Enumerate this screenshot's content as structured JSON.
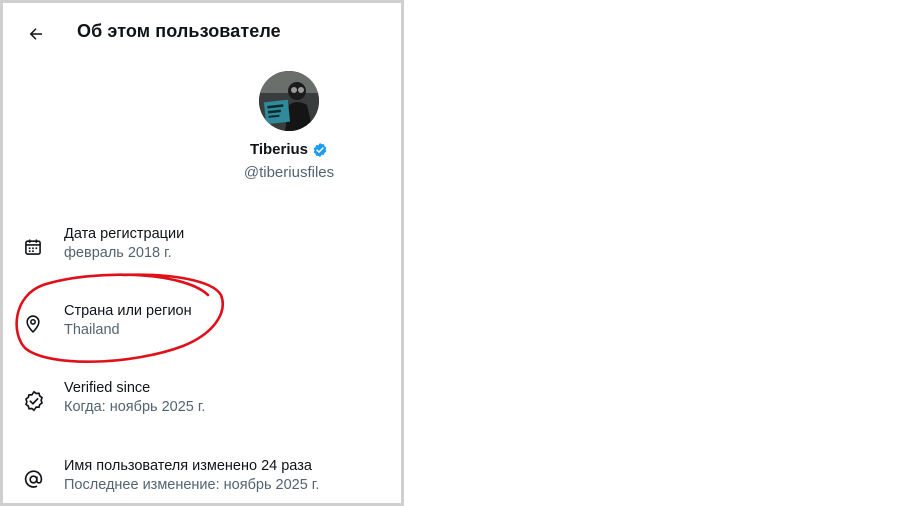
{
  "header": {
    "title": "Об этом пользователе"
  },
  "profile": {
    "name": "Tiberius",
    "handle": "@tiberiusfiles"
  },
  "rows": [
    {
      "title": "Дата регистрации",
      "subtitle": "февраль 2018 г.",
      "icon": "calendar-icon"
    },
    {
      "title": "Страна или регион",
      "subtitle": "Thailand",
      "icon": "location-pin-icon"
    },
    {
      "title": "Verified since",
      "subtitle": "Когда: ноябрь 2025 г.",
      "icon": "verified-check-icon"
    },
    {
      "title": "Имя пользователя изменено 24 раза",
      "subtitle": "Последнее изменение: ноябрь 2025 г.",
      "icon": "at-sign-icon"
    }
  ],
  "colors": {
    "text_primary": "#0f1419",
    "text_secondary": "#536471",
    "verified_badge": "#1d9bf0",
    "annotation_circle": "#e0101a"
  }
}
